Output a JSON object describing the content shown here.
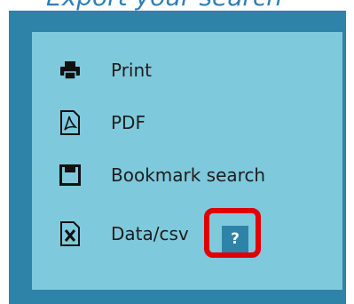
{
  "heading": {
    "text": "Export your search"
  },
  "menu": {
    "items": [
      {
        "label": "Print",
        "icon": "printer-icon"
      },
      {
        "label": "PDF",
        "icon": "pdf-icon"
      },
      {
        "label": "Bookmark search",
        "icon": "bookmark-icon"
      },
      {
        "label": "Data/csv",
        "icon": "excel-icon"
      }
    ]
  },
  "help": {
    "label": "?"
  },
  "colors": {
    "outer_panel": "#2e83a8",
    "inner_panel": "#7fc9dc",
    "highlight": "#e00000",
    "help_button": "#2e83a8"
  }
}
